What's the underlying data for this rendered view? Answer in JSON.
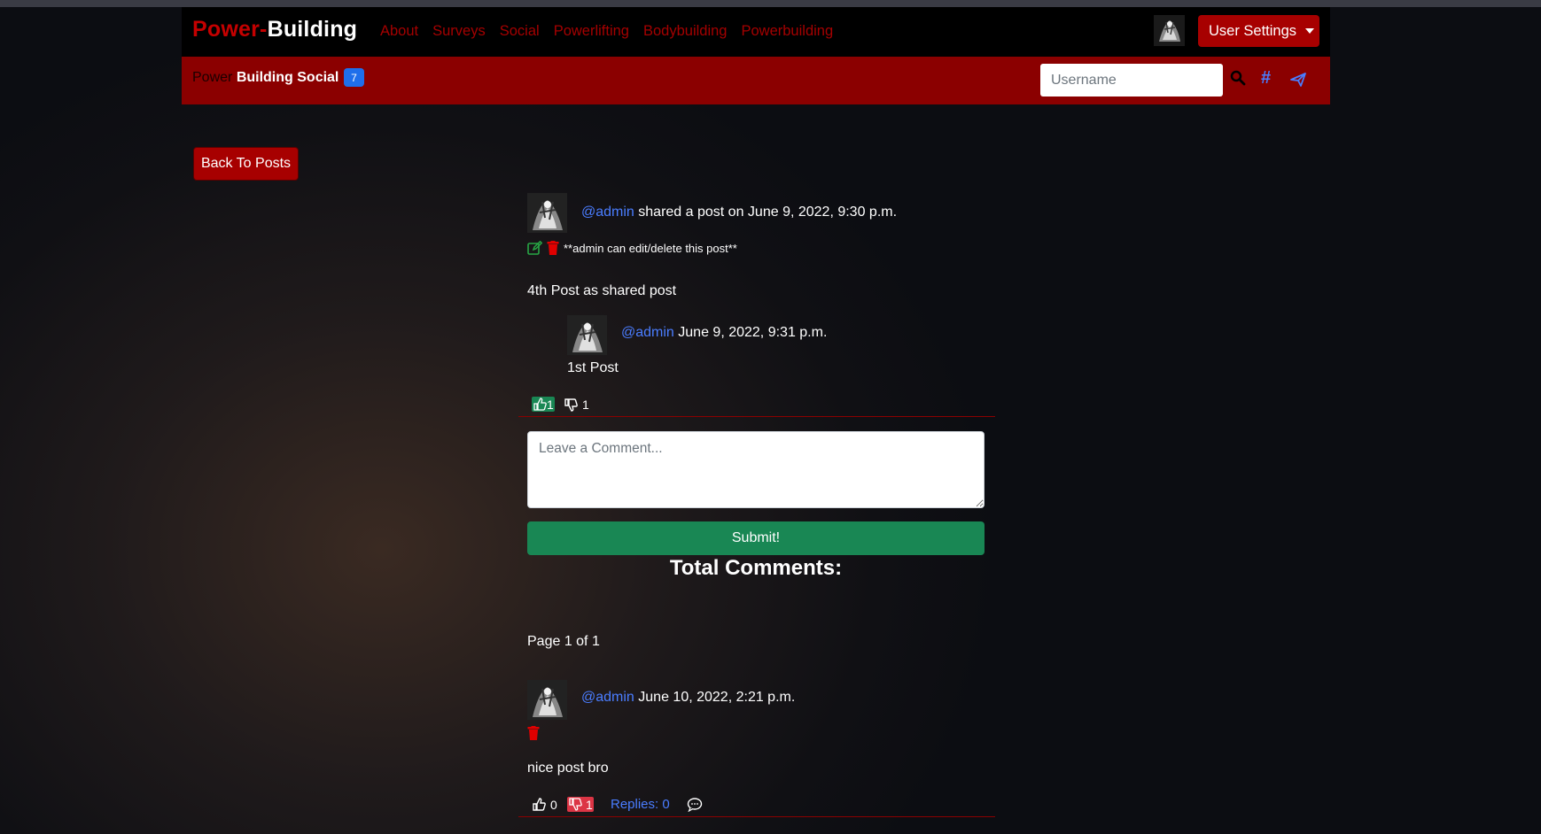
{
  "navbar": {
    "brand_part1": "Power-",
    "brand_part2": "Building",
    "links": [
      "About",
      "Surveys",
      "Social",
      "Powerlifting",
      "Bodybuilding",
      "Powerbuilding"
    ],
    "user_settings_label": "User Settings"
  },
  "subnav": {
    "title_prefix": "Power",
    "title_rest": "Building Social",
    "badge_count": "7",
    "search_placeholder": "Username",
    "hashtag_symbol": "#"
  },
  "back_button_label": "Back To Posts",
  "post": {
    "author": "@admin",
    "meta_text": "shared a post on June 9, 2022, 9:30 p.m.",
    "admin_note": "**admin can edit/delete this post**",
    "body": "4th Post as shared post",
    "shared": {
      "author": "@admin",
      "date": "June 9, 2022, 9:31 p.m.",
      "body": "1st Post"
    },
    "likes": "1",
    "dislikes": "1"
  },
  "comment_form": {
    "placeholder": "Leave a Comment...",
    "submit_label": "Submit!"
  },
  "total_comments_label": "Total Comments:",
  "pagination_text": "Page 1 of 1",
  "comments": [
    {
      "author": "@admin",
      "date": "June 10, 2022, 2:21 p.m.",
      "body": "nice post bro",
      "likes": "0",
      "dislikes": "1",
      "replies_label": "Replies: 0"
    }
  ],
  "colors": {
    "brand_red": "#c40000",
    "subnav_red": "#8b0000",
    "button_red": "#a70000",
    "link_blue": "#4a7dff",
    "submit_green": "#198754",
    "badge_blue": "#1f6feb"
  }
}
